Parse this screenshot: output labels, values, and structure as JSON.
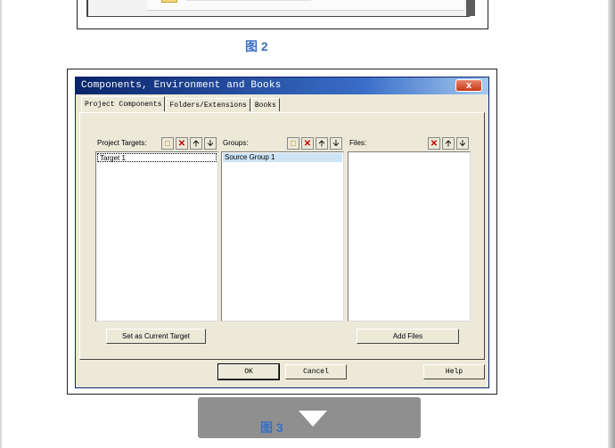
{
  "captions": {
    "fig2": "图 2",
    "fig3": "图 3"
  },
  "dialog": {
    "title": "Components, Environment and Books",
    "close_label": "x",
    "tabs": [
      {
        "label": "Project Components"
      },
      {
        "label": "Folders/Extensions"
      },
      {
        "label": "Books"
      }
    ],
    "targets": {
      "label": "Project Targets:",
      "items": [
        "Target 1"
      ]
    },
    "groups": {
      "label": "Groups:",
      "items": [
        "Source Group 1"
      ]
    },
    "files": {
      "label": "Files:",
      "items": []
    },
    "buttons": {
      "set_current": "Set as Current Target",
      "add_files": "Add Files",
      "ok": "OK",
      "cancel": "Cancel",
      "help": "Help"
    }
  },
  "icons": {
    "new": "new-folder-icon",
    "delete": "delete-x-icon",
    "up": "move-up-arrow-icon",
    "down": "move-down-arrow-icon",
    "overlay": "chevron-down-icon"
  },
  "colors": {
    "caption": "#3a6fc4",
    "titlebar": "#0a246a",
    "selection": "#cde4f7",
    "delete": "#c00000"
  }
}
